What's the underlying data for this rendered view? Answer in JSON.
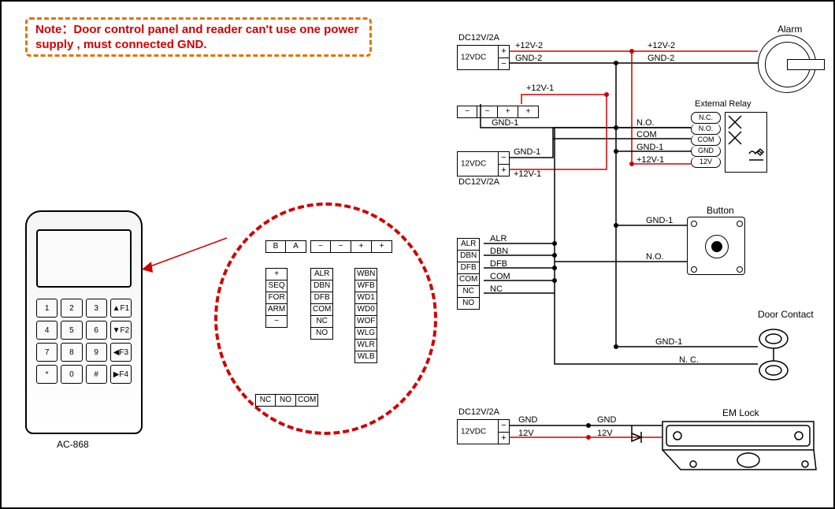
{
  "note": "Note：Door control panel and  reader can't use one power supply , must connected GND.",
  "model": "AC-868",
  "keypad": [
    "1",
    "2",
    "3",
    "▲F1",
    "4",
    "5",
    "6",
    "▼F2",
    "7",
    "8",
    "9",
    "◀F3",
    "*",
    "0",
    "#",
    "▶F4"
  ],
  "zoom_power_row": [
    "−",
    "−",
    "+",
    "+"
  ],
  "zoom_ba_row": [
    "B",
    "A"
  ],
  "zoom_col1": [
    "+",
    "SEQ",
    "FOR",
    "ARM",
    "−"
  ],
  "zoom_col2": [
    "ALR",
    "DBN",
    "DFB",
    "COM",
    "NC",
    "NO"
  ],
  "zoom_col3": [
    "WBN",
    "WFB",
    "WD1",
    "WD0",
    "WOF",
    "WLG",
    "WLR",
    "WLB"
  ],
  "zoom_bottom_row": [
    "NC",
    "NO",
    "COM"
  ],
  "right_power_row": [
    "−",
    "−",
    "+",
    "+"
  ],
  "right_signal_col": [
    "ALR",
    "DBN",
    "DFB",
    "COM",
    "NC",
    "NO"
  ],
  "psu_top": {
    "t": "DC12V/2A",
    "v": "12VDC",
    "pp": "+",
    "pm": "−"
  },
  "psu_mid": {
    "t": "DC12V/2A",
    "v": "12VDC",
    "pp": "+",
    "pm": "−"
  },
  "psu_bot": {
    "t": "DC12V/2A",
    "v": "12VDC",
    "pp": "+",
    "pm": "−"
  },
  "relay_label": "External Relay",
  "relay_pins": [
    "N.C.",
    "N.O.",
    "COM",
    "GND",
    "12V"
  ],
  "alarm_label": "Alarm",
  "button_label": "Button",
  "contact_label": "Door Contact",
  "lock_label": "EM Lock",
  "wires": {
    "p12v2": "+12V-2",
    "p12v2b": "+12V-2",
    "gnd2": "GND-2",
    "gnd2b": "GND-2",
    "p12v1": "+12V-1",
    "p12v1b": "+12V-1",
    "gnd1": "GND-1",
    "gnd1b": "GND-1",
    "gnd1c": "GND-1",
    "gnd1d": "GND-1",
    "p12v1c": "+12V-1",
    "no": "N.O.",
    "no2": "N.O.",
    "com": "COM",
    "alr": "ALR",
    "dbn": "DBN",
    "dfb": "DFB",
    "com2": "COM",
    "nc": "NC",
    "nc2": "N. C.",
    "gndL": "GND",
    "gndLb": "GND",
    "v12": "12V",
    "v12b": "12V"
  }
}
